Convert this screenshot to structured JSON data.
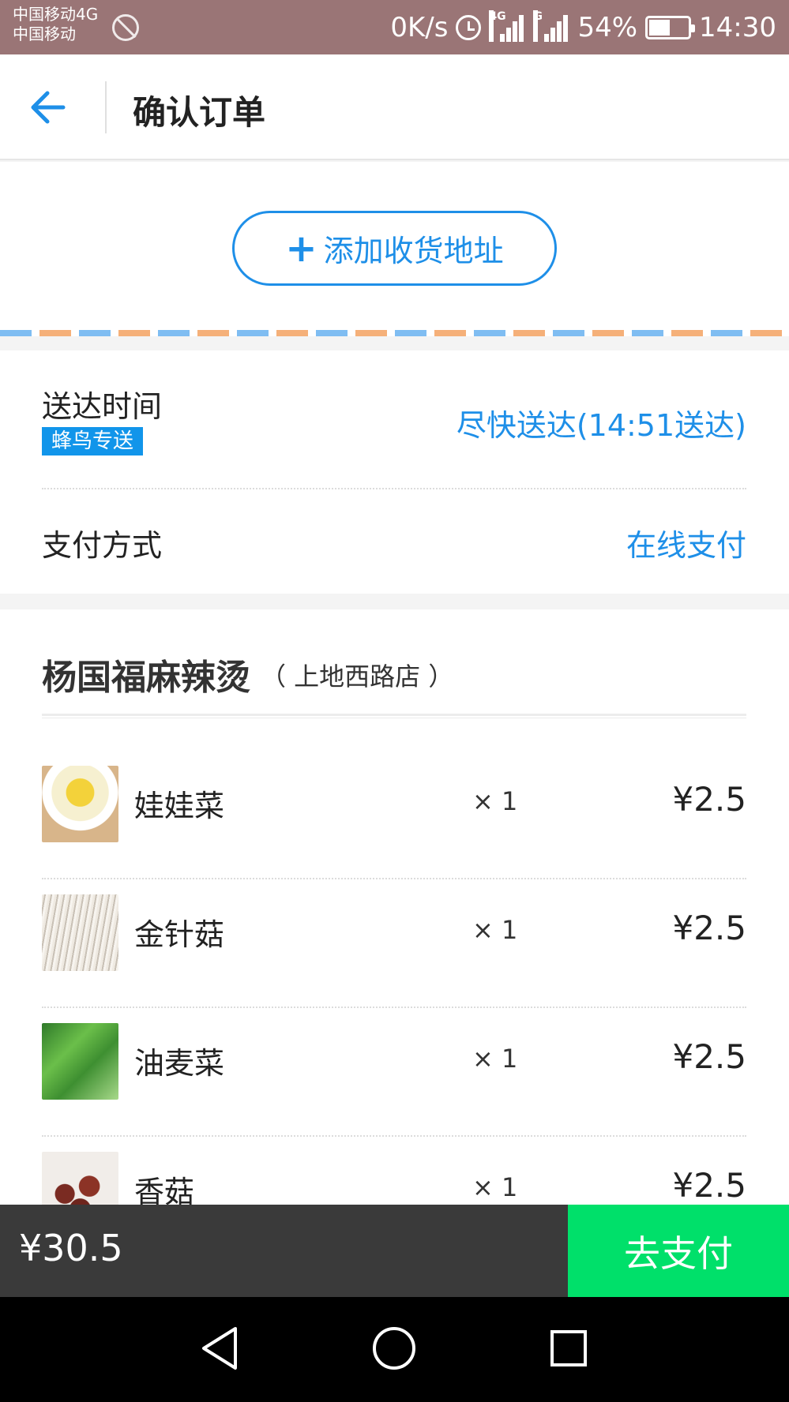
{
  "status_bar": {
    "carrier_1": "中国移动4G",
    "carrier_2": "中国移动",
    "net_speed": "0K/s",
    "net_type_1": "4G",
    "net_type_2": "G",
    "battery": "54%",
    "battery_level": 0.54,
    "time": "14:30"
  },
  "header": {
    "title": "确认订单",
    "back_icon": "arrow-left-icon"
  },
  "address": {
    "add_label": "添加收货地址",
    "icon": "plus-icon"
  },
  "delivery": {
    "time_label": "送达时间",
    "badge": "蜂鸟专送",
    "time_value": "尽快送达(14:51送达)",
    "payment_label": "支付方式",
    "payment_value": "在线支付"
  },
  "shop": {
    "name": "杨国福麻辣烫",
    "branch": "（ 上地西路店 ）",
    "items": [
      {
        "name": "娃娃菜",
        "qty": "× 1",
        "price": "¥2.5"
      },
      {
        "name": "金针菇",
        "qty": "× 1",
        "price": "¥2.5"
      },
      {
        "name": "油麦菜",
        "qty": "× 1",
        "price": "¥2.5"
      },
      {
        "name": "香菇",
        "qty": "× 1",
        "price": "¥2.5"
      }
    ]
  },
  "footer": {
    "total": "¥30.5",
    "pay_label": "去支付"
  },
  "colors": {
    "accent": "#1e8fe8",
    "pay": "#00e06a",
    "status_bar": "#9a7576",
    "footer": "#3a3a3a"
  }
}
